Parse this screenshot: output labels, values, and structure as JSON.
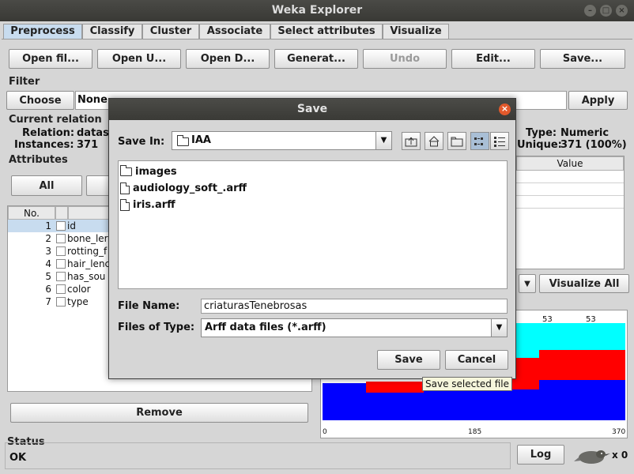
{
  "window": {
    "title": "Weka Explorer"
  },
  "tabs": [
    "Preprocess",
    "Classify",
    "Cluster",
    "Associate",
    "Select attributes",
    "Visualize"
  ],
  "toolbar": {
    "open_file": "Open fil...",
    "open_url": "Open U...",
    "open_db": "Open D...",
    "generate": "Generat...",
    "undo": "Undo",
    "edit": "Edit...",
    "save": "Save..."
  },
  "filter": {
    "title": "Filter",
    "choose": "Choose",
    "value": "None",
    "apply": "Apply"
  },
  "current_relation": {
    "title": "Current relation",
    "relation_label": "Relation:",
    "relation_value": "datas",
    "instances_label": "Instances:",
    "instances_value": "371"
  },
  "selected_attribute": {
    "type_label": "Type:",
    "type_value": "Numeric",
    "unique_label": "Unique:",
    "unique_value": "371 (100%)",
    "value_header": "Value"
  },
  "attributes": {
    "title": "Attributes",
    "all_button": "All",
    "col_no": "No.",
    "rows": [
      {
        "no": "1",
        "name": "id"
      },
      {
        "no": "2",
        "name": "bone_ler"
      },
      {
        "no": "3",
        "name": "rotting_f"
      },
      {
        "no": "4",
        "name": "hair_lenc"
      },
      {
        "no": "5",
        "name": "has_sou"
      },
      {
        "no": "6",
        "name": "color"
      },
      {
        "no": "7",
        "name": "type"
      }
    ],
    "remove_button": "Remove"
  },
  "visualize": {
    "visualize_all": "Visualize All",
    "bar_labels": [
      "53",
      "53"
    ],
    "axis_ticks": [
      "0",
      "185",
      "370"
    ]
  },
  "status": {
    "title": "Status",
    "text": "OK",
    "log_button": "Log",
    "count": "x 0"
  },
  "save_dialog": {
    "title": "Save",
    "save_in_label": "Save In:",
    "save_in_value": "IAA",
    "files": [
      {
        "name": "images",
        "icon": "folder-icon"
      },
      {
        "name": "audiology_soft_.arff",
        "icon": "file-icon"
      },
      {
        "name": "iris.arff",
        "icon": "file-icon"
      }
    ],
    "file_name_label": "File Name:",
    "file_name_value": "criaturasTenebrosas",
    "files_of_type_label": "Files of Type:",
    "files_of_type_value": "Arff data files (*.arff)",
    "save_button": "Save",
    "cancel_button": "Cancel",
    "tooltip": "Save selected file"
  },
  "colors": {
    "bar_blue": "#0000ff",
    "bar_red": "#ff0000",
    "bar_cyan": "#00ffff",
    "selected_tab": "#c8dcef",
    "title_bar": "#3c3c38",
    "close_button": "#e2592b"
  }
}
